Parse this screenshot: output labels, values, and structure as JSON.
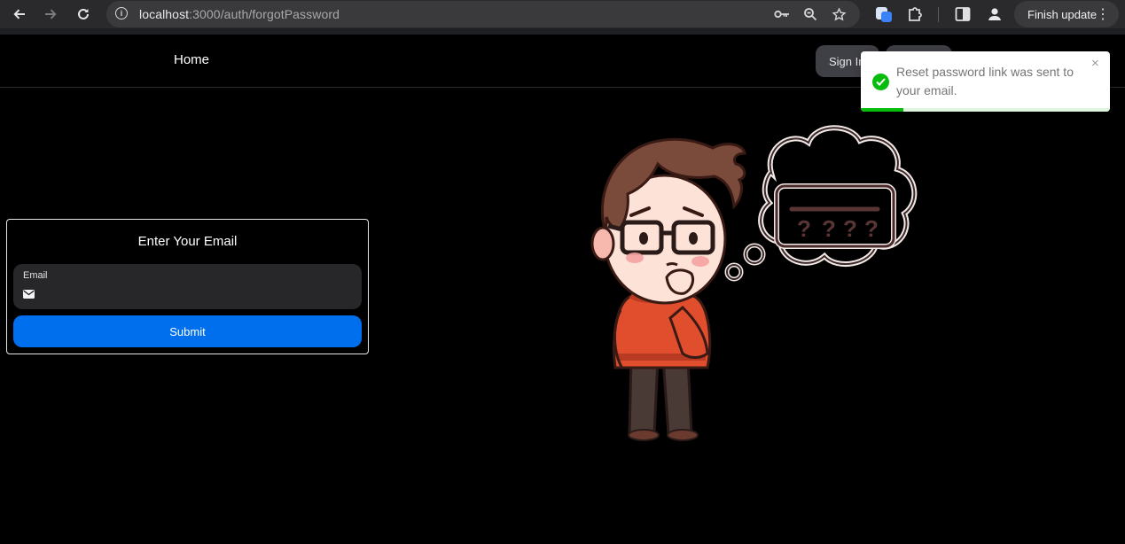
{
  "browser": {
    "url_host": "localhost",
    "url_path": ":3000/auth/forgotPassword",
    "update_label": "Finish update",
    "icons": [
      "back-icon",
      "forward-icon",
      "reload-icon",
      "info-icon",
      "key-icon",
      "zoom-icon",
      "star-icon",
      "extension-icon",
      "puzzle-icon",
      "sidepanel-icon",
      "profile-icon",
      "menu-icon"
    ]
  },
  "nav": {
    "home_label": "Home",
    "signin_label": "Sign In",
    "signup_label": "Sign Up"
  },
  "toast": {
    "message": "Reset password link was sent to your email.",
    "close_glyph": "×",
    "progress": 0.17,
    "accent": "#07bc0c"
  },
  "form": {
    "title": "Enter Your Email",
    "email_label": "Email",
    "email_value": "",
    "submit_label": "Submit",
    "accent": "#006fee"
  }
}
